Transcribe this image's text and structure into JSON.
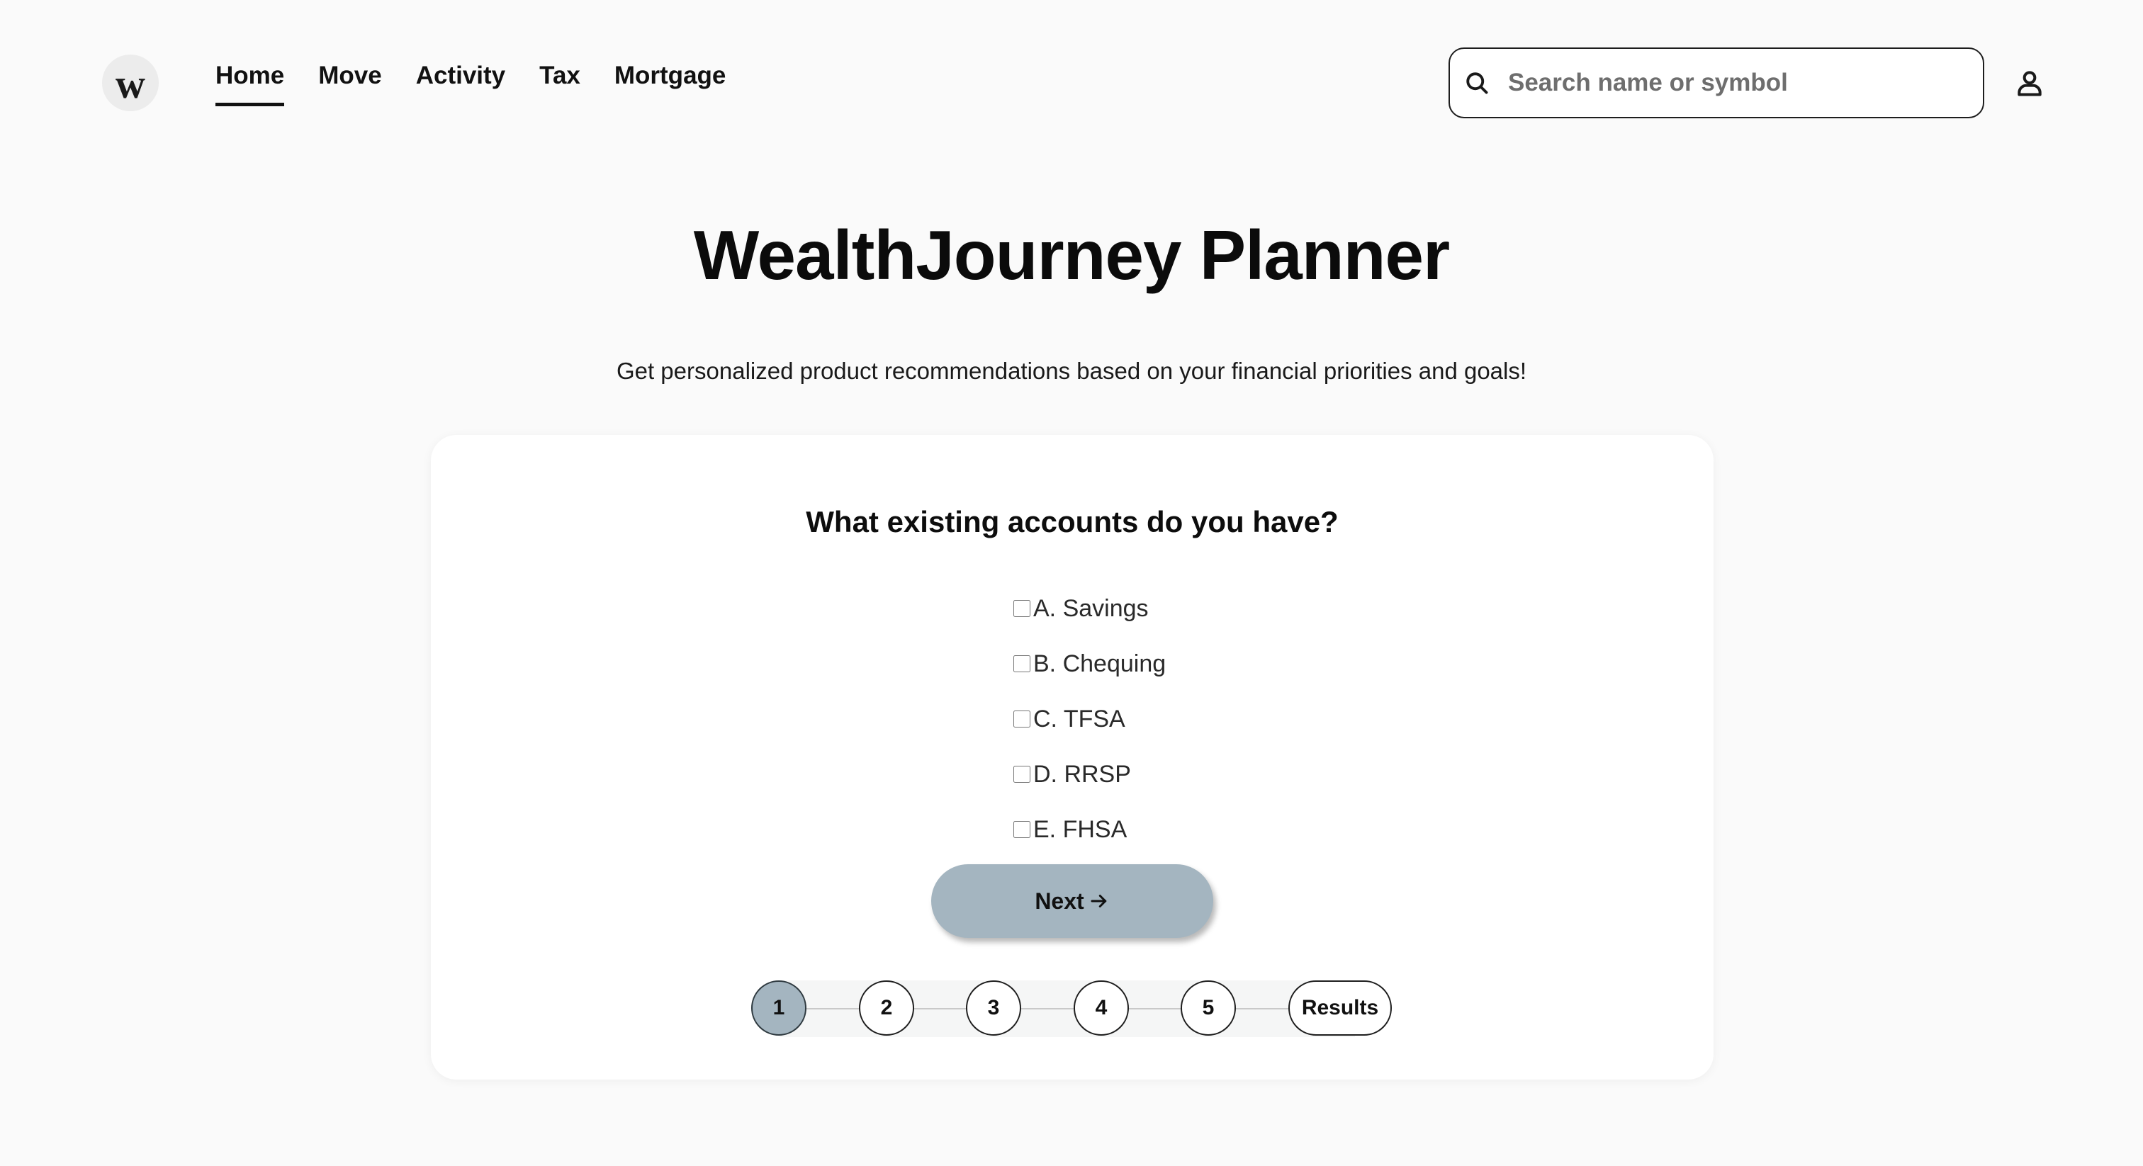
{
  "app": {
    "logo_letter": "w"
  },
  "nav": {
    "items": [
      {
        "label": "Home",
        "active": true
      },
      {
        "label": "Move",
        "active": false
      },
      {
        "label": "Activity",
        "active": false
      },
      {
        "label": "Tax",
        "active": false
      },
      {
        "label": "Mortgage",
        "active": false
      }
    ]
  },
  "search": {
    "placeholder": "Search name or symbol",
    "value": ""
  },
  "hero": {
    "title": "WealthJourney Planner",
    "subtitle": "Get personalized product recommendations based on your financial priorities and goals!"
  },
  "question": {
    "text": "What existing accounts do you have?",
    "options": [
      {
        "label": "A. Savings",
        "checked": false
      },
      {
        "label": "B. Chequing",
        "checked": false
      },
      {
        "label": "C. TFSA",
        "checked": false
      },
      {
        "label": "D. RRSP",
        "checked": false
      },
      {
        "label": "E. FHSA",
        "checked": false
      }
    ],
    "next_label": "Next"
  },
  "stepper": {
    "steps": [
      "1",
      "2",
      "3",
      "4",
      "5"
    ],
    "results_label": "Results",
    "current_step": 1
  },
  "colors": {
    "background": "#fafafa",
    "accent": "#a4b5c0",
    "text": "#111111"
  },
  "icons": {
    "search": "search-icon",
    "profile": "user-icon",
    "next": "arrow-right-icon"
  }
}
